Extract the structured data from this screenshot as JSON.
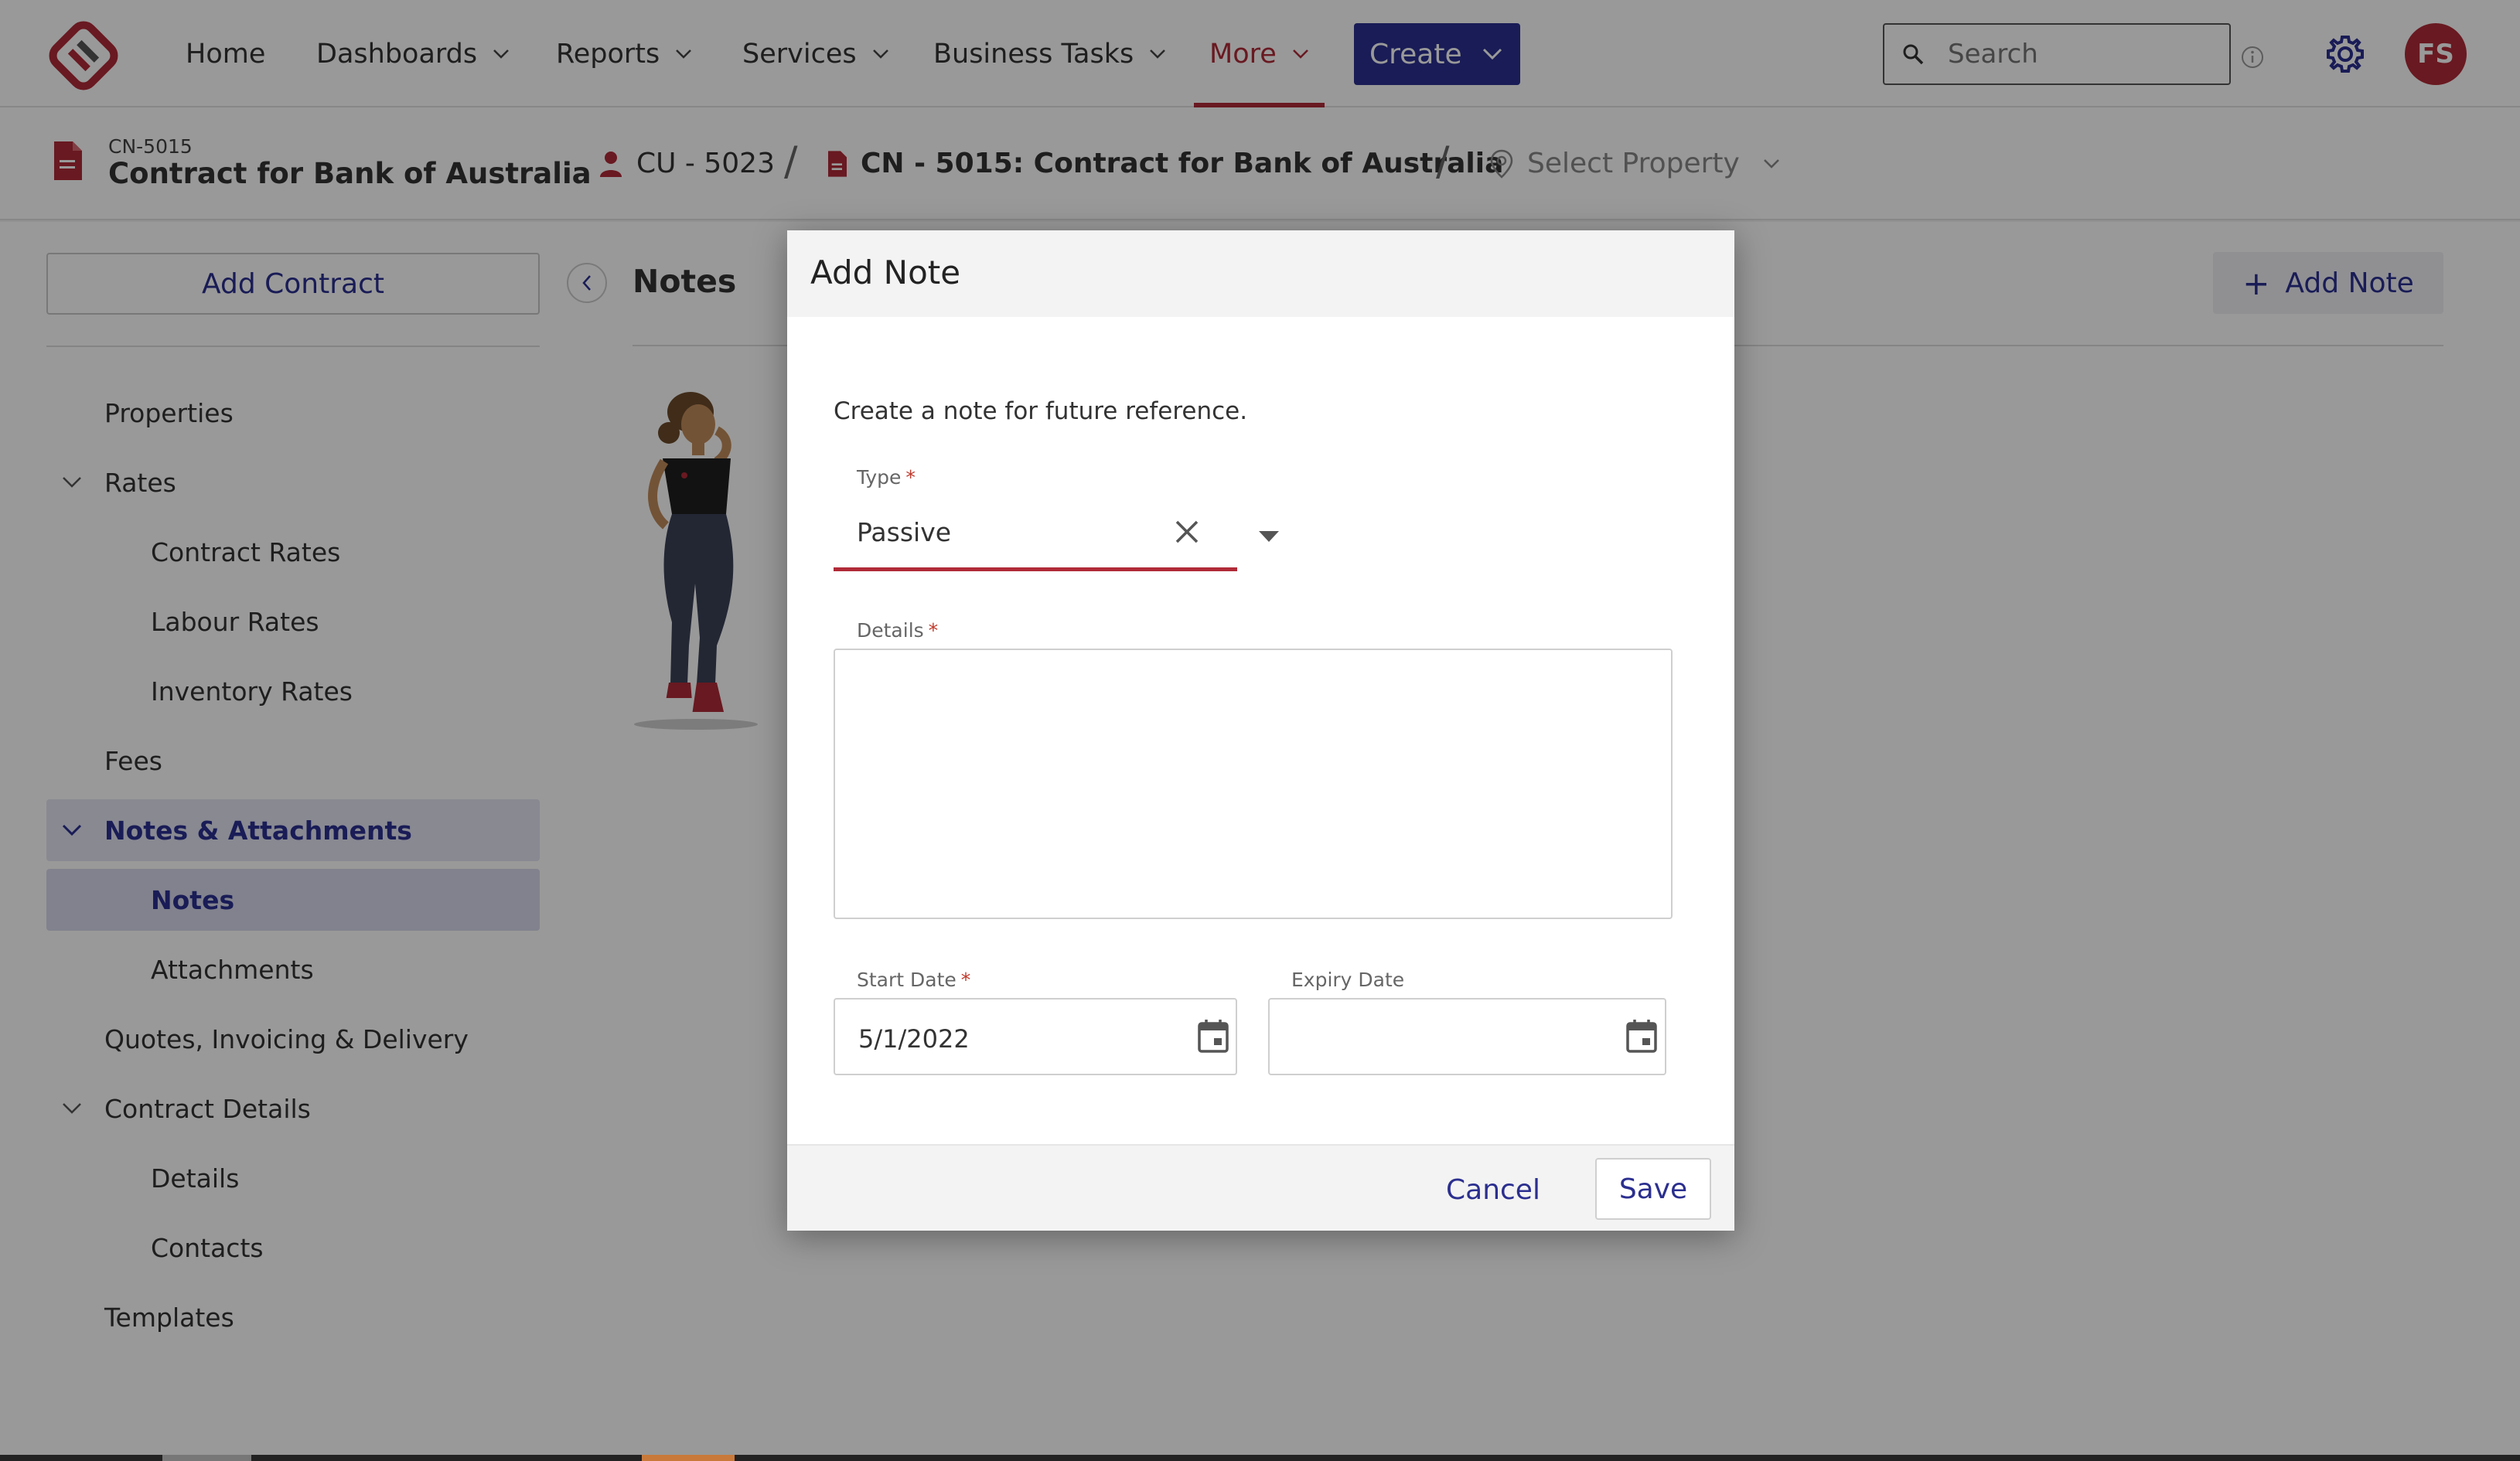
{
  "nav": {
    "items": [
      {
        "label": "Home",
        "has_dropdown": false
      },
      {
        "label": "Dashboards",
        "has_dropdown": true
      },
      {
        "label": "Reports",
        "has_dropdown": true
      },
      {
        "label": "Services",
        "has_dropdown": true
      },
      {
        "label": "Business Tasks",
        "has_dropdown": true
      },
      {
        "label": "More",
        "has_dropdown": true,
        "active": true
      }
    ],
    "create_label": "Create",
    "search_placeholder": "Search",
    "avatar_initials": "FS"
  },
  "record": {
    "code": "CN-5015",
    "title": "Contract for Bank of Australia"
  },
  "breadcrumb": {
    "customer": "CU - 5023",
    "contract": "CN - 5015: Contract for Bank of Australia",
    "property": "Select Property"
  },
  "sidebar": {
    "add_button": "Add Contract",
    "items": [
      {
        "label": "Properties",
        "level": 1
      },
      {
        "label": "Rates",
        "level": 1,
        "expandable": true
      },
      {
        "label": "Contract Rates",
        "level": 2
      },
      {
        "label": "Labour Rates",
        "level": 2
      },
      {
        "label": "Inventory Rates",
        "level": 2
      },
      {
        "label": "Fees",
        "level": 1
      },
      {
        "label": "Notes & Attachments",
        "level": 1,
        "expandable": true,
        "active": true
      },
      {
        "label": "Notes",
        "level": 2,
        "active": true
      },
      {
        "label": "Attachments",
        "level": 2
      },
      {
        "label": "Quotes, Invoicing & Delivery",
        "level": 1
      },
      {
        "label": "Contract Details",
        "level": 1,
        "expandable": true
      },
      {
        "label": "Details",
        "level": 2
      },
      {
        "label": "Contacts",
        "level": 2
      },
      {
        "label": "Templates",
        "level": 1
      }
    ]
  },
  "main": {
    "title": "Notes",
    "add_button": "Add Note"
  },
  "modal": {
    "title": "Add Note",
    "description": "Create a note for future reference.",
    "type_label": "Type",
    "type_value": "Passive",
    "details_label": "Details",
    "details_value": "",
    "start_date_label": "Start Date",
    "start_date_value": "5/1/2022",
    "expiry_date_label": "Expiry Date",
    "expiry_date_value": "",
    "required_marker": "*",
    "cancel_label": "Cancel",
    "save_label": "Save"
  },
  "colors": {
    "brand": "#2b2f8f",
    "accent": "#b02a37",
    "overlay": "rgba(0,0,0,0.40)"
  }
}
